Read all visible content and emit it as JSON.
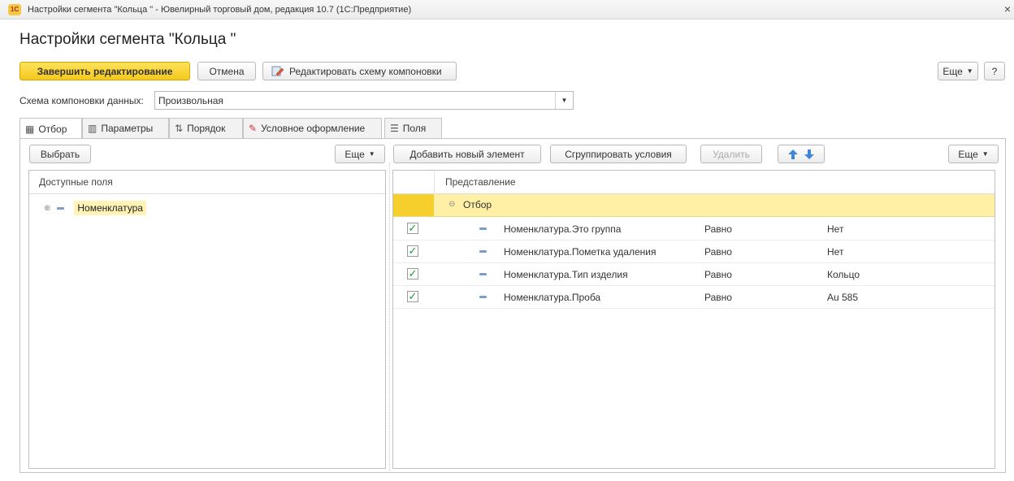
{
  "window": {
    "title": "Настройки сегмента \"Кольца \" - Ювелирный торговый дом, редакция 10.7  (1С:Предприятие)",
    "logo_text": "1С",
    "close_glyph": "×"
  },
  "page": {
    "title": "Настройки сегмента \"Кольца \""
  },
  "toolbar": {
    "finish_label": "Завершить редактирование",
    "cancel_label": "Отмена",
    "edit_schema_label": "Редактировать схему компоновки",
    "more_label": "Еще",
    "help_label": "?"
  },
  "schema": {
    "label": "Схема компоновки данных:",
    "value": "Произвольная"
  },
  "tabs": [
    {
      "label": "Отбор",
      "icon": "filter-icon"
    },
    {
      "label": "Параметры",
      "icon": "parameters-icon"
    },
    {
      "label": "Порядок",
      "icon": "order-icon"
    },
    {
      "label": "Условное оформление",
      "icon": "conditional-format-icon"
    },
    {
      "label": "Поля",
      "icon": "fields-icon"
    }
  ],
  "left_panel": {
    "select_label": "Выбрать",
    "more_label": "Еще",
    "header": "Доступные поля",
    "tree": [
      {
        "label": "Номенклатура"
      }
    ]
  },
  "right_panel": {
    "add_label": "Добавить новый элемент",
    "group_label": "Сгруппировать условия",
    "delete_label": "Удалить",
    "more_label": "Еще",
    "header": "Представление",
    "group_row": "Отбор",
    "rows": [
      {
        "field": "Номенклатура.Это группа",
        "condition": "Равно",
        "value": "Нет",
        "checked": true
      },
      {
        "field": "Номенклатура.Пометка удаления",
        "condition": "Равно",
        "value": "Нет",
        "checked": true
      },
      {
        "field": "Номенклатура.Тип изделия",
        "condition": "Равно",
        "value": "Кольцо",
        "checked": true
      },
      {
        "field": "Номенклатура.Проба",
        "condition": "Равно",
        "value": "Au 585",
        "checked": true
      }
    ]
  },
  "colors": {
    "primary_button": "#f4c81c",
    "selection_row": "#fff0a5",
    "selection_gutter": "#f6cf2d",
    "checkbox_mark": "#1f9a2c"
  }
}
